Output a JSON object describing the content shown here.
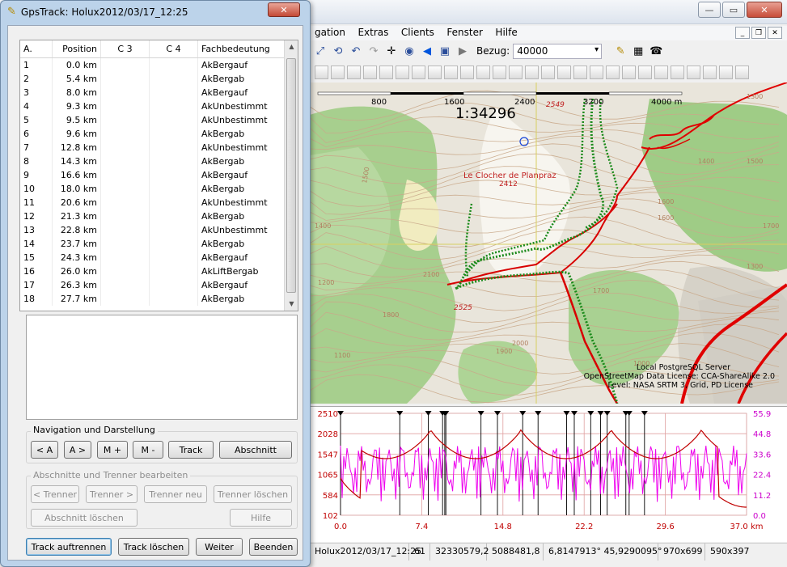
{
  "main": {
    "menu": [
      "gation",
      "Extras",
      "Clients",
      "Fenster",
      "Hilfe"
    ],
    "bezug_label": "Bezug:",
    "bezug_value": "40000",
    "map": {
      "scale_label": "1:34296",
      "scale_ticks": [
        "800",
        "1600",
        "2400",
        "3200",
        "4000 m"
      ],
      "peak_name": "Le Clocher de Planpraz",
      "peak_elev": "2412",
      "spot_2549": "2549",
      "spot_2525": "2525",
      "contour_labels": [
        "1500",
        "1400",
        "1600",
        "1700",
        "1800",
        "1900",
        "2000",
        "2100",
        "1300",
        "1600",
        "1700",
        "1000",
        "1100",
        "1200",
        "1300",
        "1400",
        "1500"
      ],
      "attribution": [
        "Local PostgreSQL Server",
        "OpenStreetMap Data License: CCA-ShareAlike 2.0",
        "Level: NASA SRTM 3, Grid, PD License"
      ]
    },
    "profile": {
      "left_ticks": [
        "2510",
        "2028",
        "1547",
        "1065",
        "584",
        "102"
      ],
      "right_ticks": [
        "55.9",
        "44.8",
        "33.6",
        "22.4",
        "11.2",
        "0.0"
      ],
      "bottom_ticks": [
        "0.0",
        "7.4",
        "14.8",
        "22.2",
        "29.6",
        "37.0 km"
      ]
    },
    "status": [
      "Holux2012/03/17_12:25",
      "61",
      "32330579,2",
      "5088481,8",
      "6,8147913° 45,9290095°",
      "970x699",
      "590x397"
    ]
  },
  "dialog": {
    "title": "GpsTrack: Holux2012/03/17_12:25",
    "close": "✕",
    "columns": [
      "A.",
      "Position",
      "C 3",
      "C 4",
      "Fachbedeutung"
    ],
    "rows": [
      {
        "a": "1",
        "pos": "0.0 km",
        "fb": "AkBergauf"
      },
      {
        "a": "2",
        "pos": "5.4 km",
        "fb": "AkBergab"
      },
      {
        "a": "3",
        "pos": "8.0 km",
        "fb": "AkBergauf"
      },
      {
        "a": "4",
        "pos": "9.3 km",
        "fb": "AkUnbestimmt"
      },
      {
        "a": "5",
        "pos": "9.5 km",
        "fb": "AkUnbestimmt"
      },
      {
        "a": "6",
        "pos": "9.6 km",
        "fb": "AkBergab"
      },
      {
        "a": "7",
        "pos": "12.8 km",
        "fb": "AkUnbestimmt"
      },
      {
        "a": "8",
        "pos": "14.3 km",
        "fb": "AkBergab"
      },
      {
        "a": "9",
        "pos": "16.6 km",
        "fb": "AkBergauf"
      },
      {
        "a": "10",
        "pos": "18.0 km",
        "fb": "AkBergab"
      },
      {
        "a": "11",
        "pos": "20.6 km",
        "fb": "AkUnbestimmt"
      },
      {
        "a": "12",
        "pos": "21.3 km",
        "fb": "AkBergab"
      },
      {
        "a": "13",
        "pos": "22.8 km",
        "fb": "AkUnbestimmt"
      },
      {
        "a": "14",
        "pos": "23.7 km",
        "fb": "AkBergab"
      },
      {
        "a": "15",
        "pos": "24.3 km",
        "fb": "AkBergauf"
      },
      {
        "a": "16",
        "pos": "26.0 km",
        "fb": "AkLiftBergab"
      },
      {
        "a": "17",
        "pos": "26.3 km",
        "fb": "AkBergauf"
      },
      {
        "a": "18",
        "pos": "27.7 km",
        "fb": "AkBergab"
      }
    ],
    "nav_group": "Navigation und Darstellung",
    "nav_buttons": [
      "< A",
      "A >",
      "M +",
      "M -",
      "Track",
      "Abschnitt"
    ],
    "edit_group": "Abschnitte und Trenner bearbeiten",
    "edit_buttons": [
      "< Trenner",
      "Trenner >",
      "Trenner neu",
      "Trenner löschen",
      "Abschnitt löschen",
      "Hilfe"
    ],
    "bottom_buttons": [
      "Track auftrennen",
      "Track löschen",
      "Weiter",
      "Beenden"
    ]
  }
}
